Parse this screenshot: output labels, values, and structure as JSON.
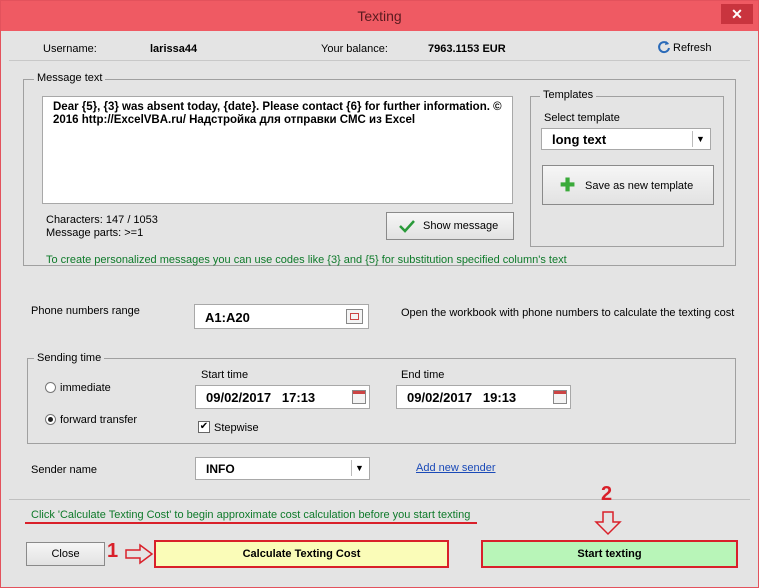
{
  "window": {
    "title": "Texting",
    "close_glyph": "✕"
  },
  "header": {
    "username_label": "Username:",
    "username_value": "larissa44",
    "balance_label": "Your balance:",
    "balance_value": "7963.1153 EUR",
    "refresh_label": "Refresh",
    "refresh_icon": "refresh-icon"
  },
  "message": {
    "group_title": "Message text",
    "text": "Dear {5}, {3} was absent today, {date}. Please contact {6} for further information. © 2016 http://ExcelVBA.ru/ Надстройка для отправки СМС из Excel",
    "characters": "Characters: 147 / 1053",
    "parts": "Message parts: >=1",
    "show_message_label": "Show message",
    "hint": "To create personalized messages you can use codes like {3} and {5} for substitution specified column's text"
  },
  "templates": {
    "group_title": "Templates",
    "select_label": "Select template",
    "selected": "long text",
    "save_label": "Save as new template"
  },
  "phones": {
    "label": "Phone numbers range",
    "value": "A1:A20",
    "hint": "Open the workbook with phone numbers to calculate the texting cost"
  },
  "sending": {
    "group_title": "Sending time",
    "immediate_label": "immediate",
    "forward_label": "forward transfer",
    "selected": "forward transfer",
    "start_label": "Start time",
    "start_value": "09/02/2017   17:13",
    "end_label": "End time",
    "end_value": "09/02/2017   19:13",
    "stepwise_label": "Stepwise",
    "stepwise_checked": true
  },
  "sender": {
    "label": "Sender name",
    "value": "INFO",
    "add_label": "Add new sender"
  },
  "footer": {
    "cost_hint": "Click 'Calculate Texting Cost' to begin approximate cost calculation before you start texting",
    "close_label": "Close",
    "calculate_label": "Calculate Texting Cost",
    "start_label": "Start texting",
    "step1": "1",
    "step2": "2"
  },
  "colors": {
    "titlebar": "#ef5a63",
    "accent_red": "#d9202a",
    "hint_green": "#0e7a2a",
    "calculate_bg": "#fafcb8",
    "start_bg": "#b8f5b8"
  }
}
